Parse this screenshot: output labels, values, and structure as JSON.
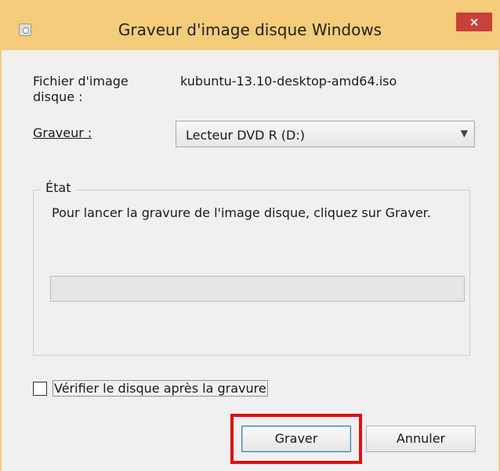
{
  "window": {
    "title": "Graveur d'image disque Windows",
    "close_label": "×",
    "icon": "disc-image-icon"
  },
  "file": {
    "label_line1": "Fichier d'image",
    "label_line2": "disque :",
    "value": "kubuntu-13.10-desktop-amd64.iso"
  },
  "burner": {
    "label": "Graveur :",
    "selected": "Lecteur DVD R (D:)"
  },
  "status": {
    "group_title": "État",
    "message": "Pour lancer la gravure de l'image disque, cliquez sur Graver.",
    "progress": 0
  },
  "verify": {
    "label": "Vérifier le disque après la gravure",
    "checked": false
  },
  "buttons": {
    "burn": "Graver",
    "cancel": "Annuler"
  },
  "colors": {
    "titlebar": "#f4cc7a",
    "close": "#c7403a",
    "highlight": "#e01010"
  }
}
